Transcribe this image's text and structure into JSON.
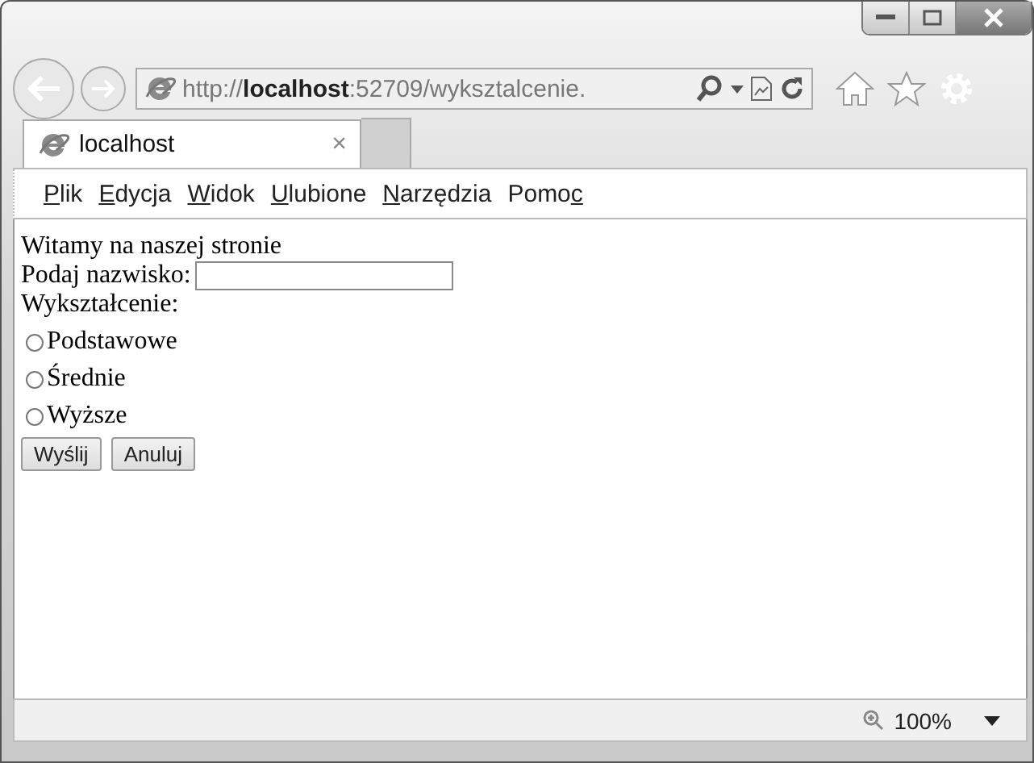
{
  "address_bar": {
    "url": "http://**localhost**:52709/wyksztalcenie."
  },
  "tabs": [
    {
      "label": "localhost",
      "selected": true,
      "close": "×"
    }
  ],
  "menu": [
    {
      "key": "P",
      "after": "lik"
    },
    {
      "key": "E",
      "after": "dycja"
    },
    {
      "key": "W",
      "after": "idok"
    },
    {
      "key": "U",
      "after": "lubione"
    },
    {
      "key": "N",
      "after": "arzędzia"
    },
    {
      "before": "Pomo",
      "key": "c"
    }
  ],
  "page": {
    "heading": "Witamy na naszej stronie",
    "name_label": "Podaj nazwisko:",
    "education_label": "Wykształcenie:",
    "options": [
      {
        "label": "Podstawowe",
        "selected": false
      },
      {
        "label": "Średnie",
        "selected": false
      },
      {
        "label": "Wyższe",
        "selected": false
      }
    ],
    "buttons": [
      "Wyślij",
      "Anuluj"
    ]
  },
  "status_bar": {
    "zoom": "100%"
  }
}
